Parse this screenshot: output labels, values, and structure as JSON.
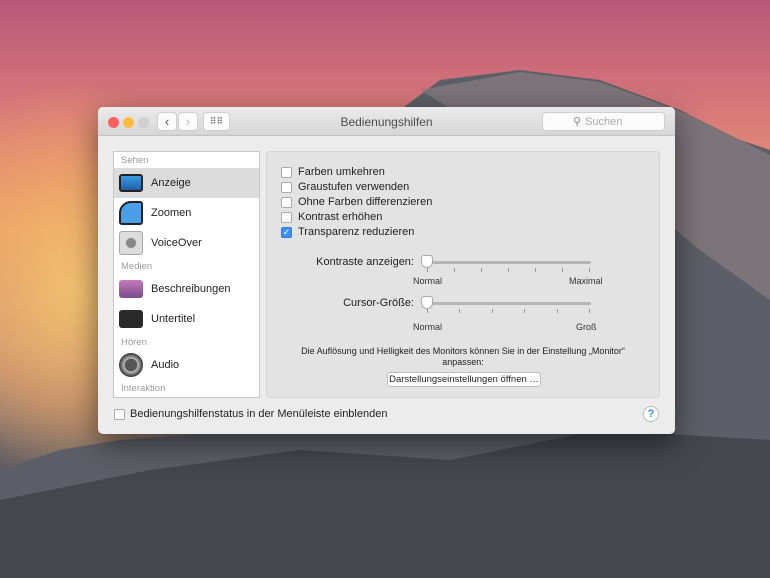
{
  "window": {
    "title": "Bedienungshilfen",
    "search_placeholder": "Suchen"
  },
  "sidebar": {
    "sections": [
      {
        "label": "Sehen",
        "items": [
          {
            "label": "Anzeige",
            "selected": true
          },
          {
            "label": "Zoomen"
          },
          {
            "label": "VoiceOver"
          }
        ]
      },
      {
        "label": "Medien",
        "items": [
          {
            "label": "Beschreibungen"
          },
          {
            "label": "Untertitel"
          }
        ]
      },
      {
        "label": "Hören",
        "items": [
          {
            "label": "Audio"
          }
        ]
      },
      {
        "label": "Interaktion",
        "items": []
      }
    ]
  },
  "options": [
    {
      "label": "Farben umkehren",
      "checked": false
    },
    {
      "label": "Graustufen verwenden",
      "checked": false
    },
    {
      "label": "Ohne Farben differenzieren",
      "checked": false
    },
    {
      "label": "Kontrast erhöhen",
      "checked": false
    },
    {
      "label": "Transparenz reduzieren",
      "checked": true
    }
  ],
  "sliders": [
    {
      "label": "Kontraste anzeigen:",
      "min_label": "Normal",
      "max_label": "Maximal",
      "value": 0
    },
    {
      "label": "Cursor-Größe:",
      "min_label": "Normal",
      "max_label": "Groß",
      "value": 0
    }
  ],
  "info_text": "Die Auflösung und Helligkeit des Monitors können Sie in der Einstellung „Monitor“ anpassen:",
  "display_button": "Darstellungseinstellungen öffnen …",
  "menubar_status": {
    "label": "Bedienungshilfenstatus in der Menüleiste einblenden",
    "checked": false
  },
  "help": "?",
  "colors": {
    "accent": "#3c8ff7",
    "close": "#fc605c",
    "minimize": "#fdbc40"
  }
}
